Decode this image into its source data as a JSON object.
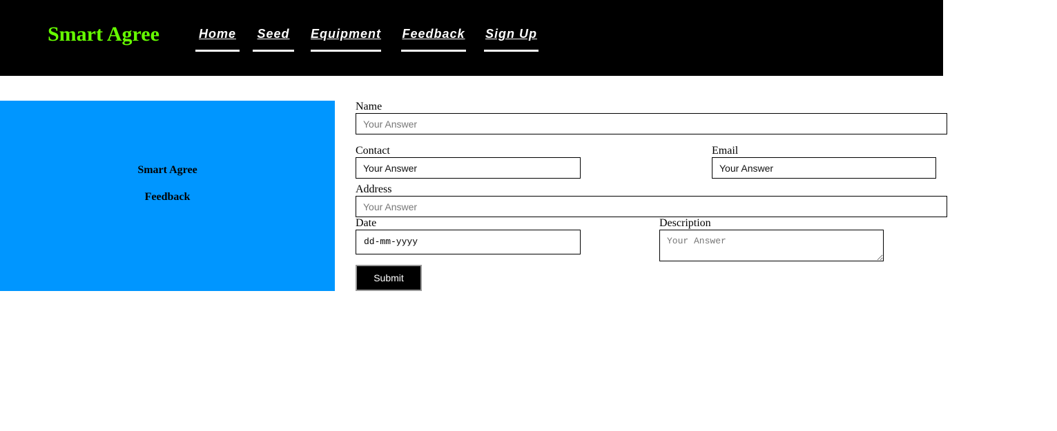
{
  "header": {
    "brand": "Smart Agree",
    "nav": [
      {
        "label": "Home"
      },
      {
        "label": "Seed"
      },
      {
        "label": "Equipment"
      },
      {
        "label": "Feedback"
      },
      {
        "label": "Sign Up"
      }
    ]
  },
  "side_panel": {
    "title": "Smart Agree",
    "subtitle": "Feedback"
  },
  "form": {
    "name_label": "Name",
    "name_placeholder": "Your Answer",
    "contact_label": "Contact",
    "contact_placeholder": "Your Answer",
    "email_label": "Email",
    "email_placeholder": "Your Answer",
    "address_label": "Address",
    "address_placeholder": "Your Answer",
    "date_label": "Date",
    "date_placeholder": "dd-mm-yyyy",
    "description_label": "Description",
    "description_placeholder": "Your Answer",
    "submit_label": "Submit"
  },
  "colors": {
    "header_bg": "#000000",
    "brand": "#66ff00",
    "side_panel_bg": "#0096ff",
    "button_bg": "#000000"
  }
}
